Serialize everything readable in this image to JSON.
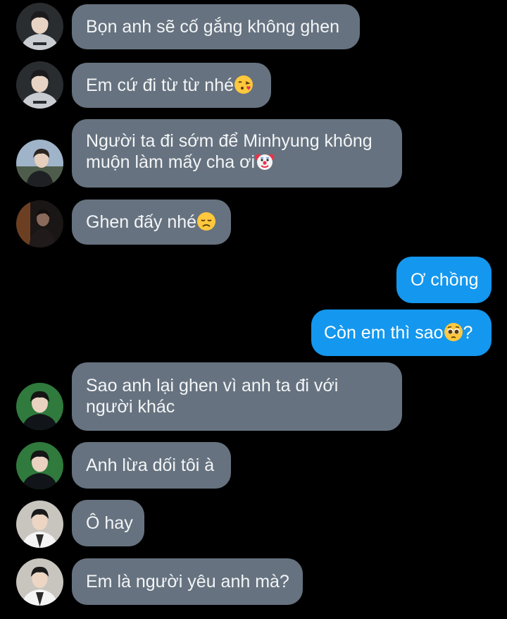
{
  "colors": {
    "background": "#000000",
    "incoming_bubble": "#66727f",
    "outgoing_bubble": "#1497ee",
    "incoming_text": "#f3f5f7",
    "outgoing_text": "#ffffff"
  },
  "messages": [
    {
      "direction": "incoming",
      "sender_avatar": "gray-hoodie-boy",
      "line1": "Bọn anh sẽ cố gắng không ghen",
      "emoji": ""
    },
    {
      "direction": "incoming",
      "sender_avatar": "gray-hoodie-boy",
      "line1": "Em cứ đi từ từ nhé",
      "emoji": "kissing-heart-emoji"
    },
    {
      "direction": "incoming",
      "sender_avatar": "outdoor-boy",
      "line1": "Người ta đi sớm để Minhyung không",
      "line2": "muộn làm mấy cha ơi",
      "emoji": "clown-face-emoji"
    },
    {
      "direction": "incoming",
      "sender_avatar": "dark-portrait",
      "line1": "Ghen đấy nhé",
      "emoji": "disappointed-face-emoji"
    },
    {
      "direction": "outgoing",
      "line1": "Ơ chồng",
      "emoji": ""
    },
    {
      "direction": "outgoing",
      "line1": "Còn em thì sao",
      "emoji": "pleading-face-emoji",
      "suffix": "?"
    },
    {
      "direction": "incoming",
      "sender_avatar": "green-background-boy",
      "line1": "Sao anh lại ghen vì anh ta đi với",
      "line2": "người khác",
      "emoji": ""
    },
    {
      "direction": "incoming",
      "sender_avatar": "green-background-boy",
      "line1": "Anh lừa dối tôi à",
      "emoji": ""
    },
    {
      "direction": "incoming",
      "sender_avatar": "white-jacket-boy",
      "line1": "Ô hay",
      "emoji": ""
    },
    {
      "direction": "incoming",
      "sender_avatar": "white-jacket-boy",
      "line1": "Em là người yêu anh mà?",
      "emoji": ""
    }
  ]
}
